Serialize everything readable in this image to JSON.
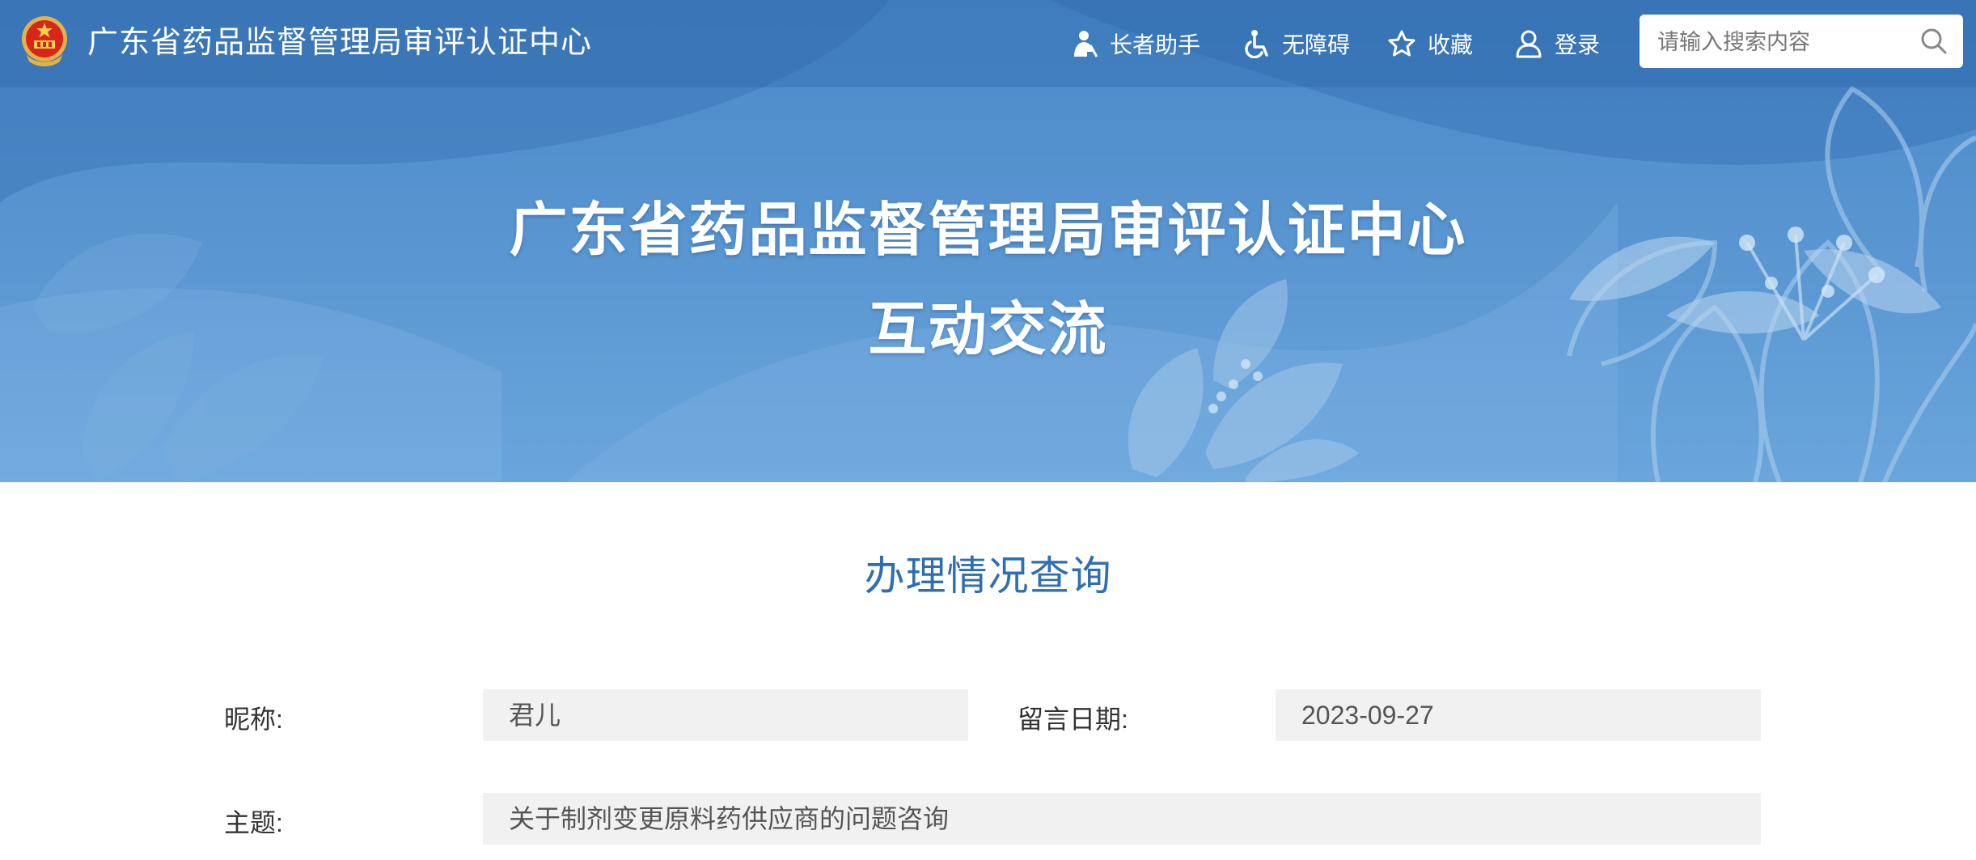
{
  "header": {
    "site_name": "广东省药品监督管理局审评认证中心",
    "tools": {
      "elder": "长者助手",
      "accessibility": "无障碍",
      "favorite": "收藏",
      "login": "登录"
    },
    "search": {
      "placeholder": "请输入搜索内容"
    }
  },
  "hero": {
    "title": "广东省药品监督管理局审评认证中心",
    "subtitle": "互动交流"
  },
  "section": {
    "title": "办理情况查询"
  },
  "form": {
    "nickname": {
      "label": "昵称:",
      "value": "君儿"
    },
    "date": {
      "label": "留言日期:",
      "value": "2023-09-27"
    },
    "subject": {
      "label": "主题:",
      "value": "关于制剂变更原料药供应商的问题咨询"
    }
  },
  "icons": [
    "national-emblem-icon",
    "elder-icon",
    "wheelchair-icon",
    "star-icon",
    "user-icon",
    "search-icon"
  ],
  "colors": {
    "banner": "#5a97d2",
    "title_blue": "#2f6eb0",
    "field_bg": "#f1f1f1"
  }
}
